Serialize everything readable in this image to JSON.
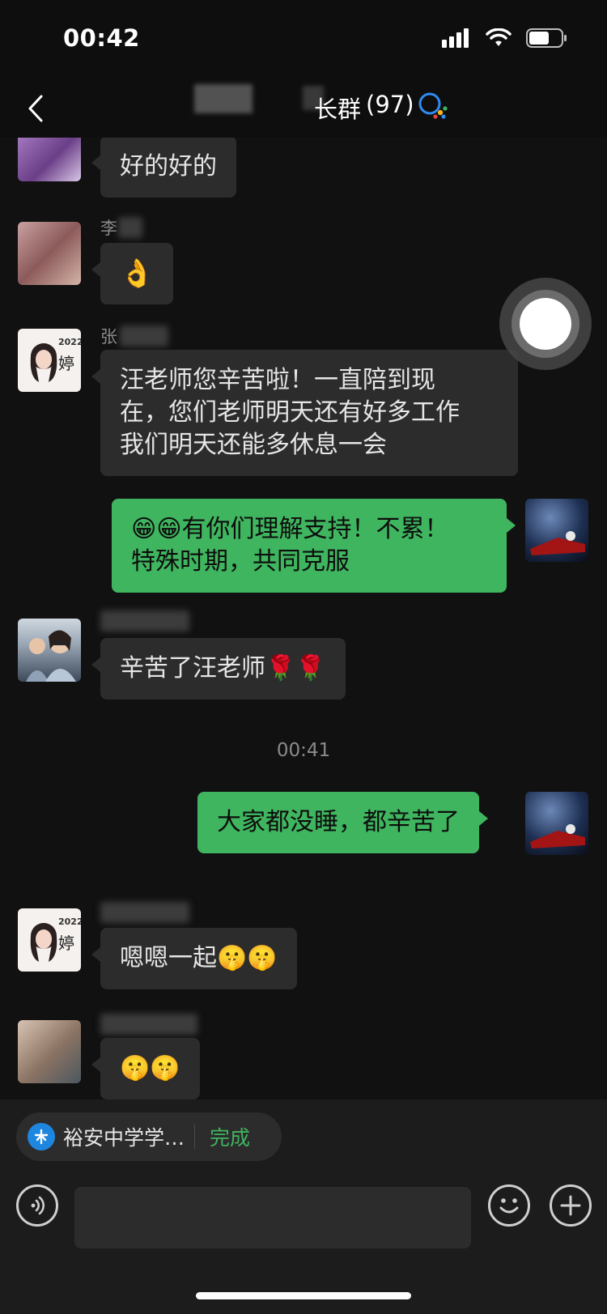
{
  "status_bar": {
    "time": "00:42"
  },
  "header": {
    "title_visible_part": "长群",
    "member_count": "(97)"
  },
  "messages": [
    {
      "sender": "",
      "direction": "in",
      "text": "好的好的"
    },
    {
      "sender": "李",
      "direction": "in",
      "text": "👌"
    },
    {
      "sender": "张",
      "direction": "in",
      "lines": [
        "汪老师您辛苦啦！一直陪到现",
        "在，您们老师明天还有好多工作",
        "我们明天还能多休息一会"
      ]
    },
    {
      "sender": "",
      "direction": "out",
      "lines": [
        "😁😁有你们理解支持！不累！",
        "特殊时期，共同克服"
      ]
    },
    {
      "sender": "",
      "direction": "in",
      "text": "辛苦了汪老师🌹🌹"
    },
    {
      "sender": "",
      "direction": "out",
      "text": "大家都没睡，都辛苦了"
    },
    {
      "sender": "",
      "direction": "in",
      "text": "嗯嗯一起🤫🤫"
    },
    {
      "sender": "",
      "direction": "in",
      "text": "🤫🤫"
    }
  ],
  "timestamp": "00:41",
  "avatar_text": {
    "year": "2022",
    "character": "婷"
  },
  "bottom": {
    "miniapp_name": "裕安中学学…",
    "miniapp_done": "完成",
    "input_value": ""
  },
  "colors": {
    "background": "#111111",
    "incoming_bubble": "#2c2c2c",
    "outgoing_bubble": "#3fb55f",
    "accent_green": "#3fb55f"
  },
  "icons": [
    "back-icon",
    "more-icon",
    "corp-wechat-icon",
    "voice-icon",
    "emoji-icon",
    "plus-icon",
    "signal-icon",
    "wifi-icon",
    "battery-icon"
  ]
}
